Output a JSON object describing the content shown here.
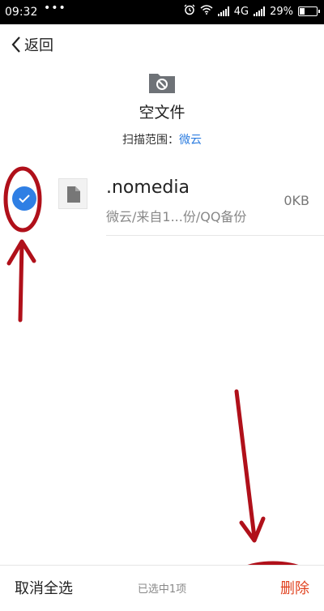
{
  "status_bar": {
    "time": "09:32",
    "dots": "•••",
    "network": "4G",
    "battery": "29%",
    "battery_level": 0.29
  },
  "header": {
    "back_label": "返回",
    "title": "空文件",
    "scan_label": "扫描范围：",
    "scan_value": "微云"
  },
  "file_item": {
    "name": ".nomedia",
    "path": "微云/来自1...份/QQ备份",
    "size": "0KB",
    "checked": true
  },
  "bottom_bar": {
    "cancel_all_label": "取消全选",
    "selected_count": "已选中1项",
    "delete_label": "删除"
  },
  "colors": {
    "accent_blue": "#2f7fe4",
    "delete_red": "#e0421f",
    "annotation_red": "#b0101a"
  },
  "icons": {
    "back": "chevron-left-icon",
    "folder": "blocked-folder-icon",
    "file": "document-icon",
    "check": "checkmark-icon"
  }
}
